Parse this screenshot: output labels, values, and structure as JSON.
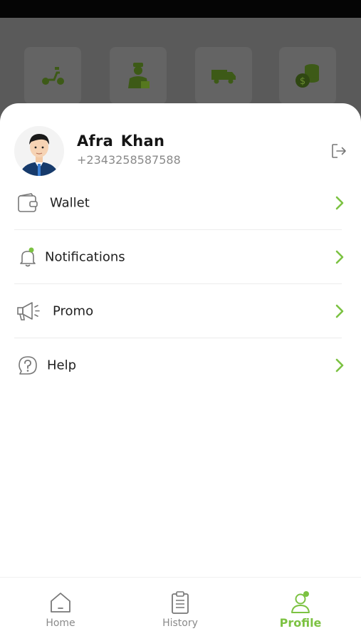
{
  "colors": {
    "accent": "#7cc242",
    "backdrop": "#5a5a5a",
    "text": "#1f1f1f",
    "muted": "#8a8a8a"
  },
  "services": [
    {
      "icon": "scooter-icon"
    },
    {
      "icon": "courier-icon"
    },
    {
      "icon": "truck-icon"
    },
    {
      "icon": "coins-icon"
    }
  ],
  "profile": {
    "name": "Afra  Khan",
    "phone": "+2343258587588",
    "logout_icon": "logout-icon"
  },
  "menu": [
    {
      "label": "Wallet",
      "icon": "wallet-icon"
    },
    {
      "label": "Notifications",
      "icon": "bell-icon"
    },
    {
      "label": "Promo",
      "icon": "megaphone-icon"
    },
    {
      "label": "Help",
      "icon": "help-icon"
    }
  ],
  "nav": {
    "home": {
      "label": "Home",
      "icon": "home-icon"
    },
    "history": {
      "label": "History",
      "icon": "clipboard-icon"
    },
    "profile": {
      "label": "Profile",
      "icon": "user-icon",
      "active": true
    }
  }
}
